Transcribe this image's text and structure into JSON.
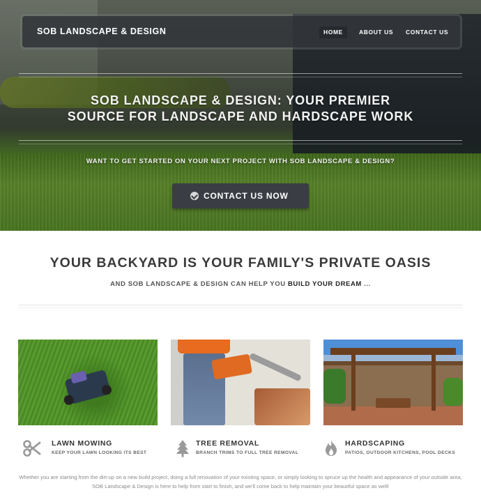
{
  "navbar": {
    "brand": "SOB LANDSCAPE & DESIGN",
    "items": [
      {
        "label": "HOME",
        "active": true
      },
      {
        "label": "ABOUT US",
        "active": false
      },
      {
        "label": "CONTACT US",
        "active": false
      }
    ]
  },
  "hero": {
    "title_line1": "SOB LANDSCAPE & DESIGN: YOUR PREMIER",
    "title_line2": "SOURCE FOR LANDSCAPE AND HARDSCAPE WORK",
    "subtitle": "WANT TO GET STARTED ON YOUR NEXT PROJECT WITH SOB LANDSCAPE & DESIGN?",
    "cta_label": "CONTACT US NOW",
    "cta_icon": "check-circle-icon"
  },
  "main": {
    "title": "YOUR BACKYARD IS YOUR FAMILY'S PRIVATE OASIS",
    "subtitle_prefix": "AND SOB LANDSCAPE & DESIGN CAN HELP YOU",
    "subtitle_bold": "BUILD YOUR DREAM",
    "subtitle_suffix": "..."
  },
  "features": [
    {
      "title": "LAWN MOWING",
      "subtitle": "KEEP YOUR LAWN LOOKING ITS BEST",
      "icon": "scissors-icon"
    },
    {
      "title": "TREE REMOVAL",
      "subtitle": "BRANCH TRIMS TO FULL TREE REMOVAL",
      "icon": "tree-icon"
    },
    {
      "title": "HARDSCAPING",
      "subtitle": "PATIOS, OUTDOOR KITCHENS, POOL DECKS",
      "icon": "fire-icon"
    }
  ],
  "paragraph": "Whether you are starting from the dirt-up on a new build project, doing a full renovation of your existing space, or simply looking to spruce up the health and appearance of your outside area, SOB Landscape & Design is here to help from start to finish, and we'll come back to help maintain your beautiful space as well!",
  "colors": {
    "navbar_bg": "#32353a",
    "cta_bg": "#3a3d44",
    "icon_gray": "#9a9a9a"
  }
}
